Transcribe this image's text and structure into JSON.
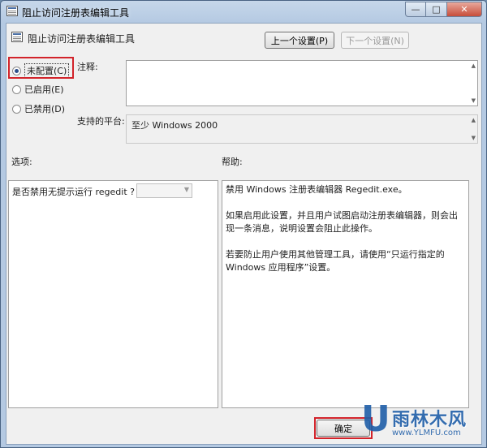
{
  "window": {
    "title": "阻止访问注册表编辑工具"
  },
  "caption": {
    "minimize": "—",
    "maximize": "□",
    "close": "✕"
  },
  "header": {
    "title": "阻止访问注册表编辑工具"
  },
  "nav": {
    "prev_label": "上一个设置(P)",
    "next_label": "下一个设置(N)"
  },
  "state": {
    "options": [
      {
        "label": "未配置(C)",
        "checked": true
      },
      {
        "label": "已启用(E)",
        "checked": false
      },
      {
        "label": "已禁用(D)",
        "checked": false
      }
    ]
  },
  "labels": {
    "comment": "注释:",
    "platform": "支持的平台:",
    "options": "选项:",
    "help": "帮助:"
  },
  "platform": {
    "value": "至少 Windows 2000"
  },
  "options_panel": {
    "question": "是否禁用无提示运行 regedit ?",
    "dropdown_value": ""
  },
  "help": {
    "paragraphs": [
      "禁用 Windows 注册表编辑器 Regedit.exe。",
      "如果启用此设置，并且用户试图启动注册表编辑器，则会出现一条消息，说明设置会阻止此操作。",
      "若要防止用户使用其他管理工具，请使用“只运行指定的 Windows 应用程序”设置。"
    ]
  },
  "footer": {
    "ok_label": "确定"
  },
  "watermark": {
    "letter": "U",
    "brand": "雨林木风",
    "url": "www.YLMFU.com"
  },
  "colors": {
    "highlight": "#d2232a",
    "brand": "#1f5ea8"
  }
}
